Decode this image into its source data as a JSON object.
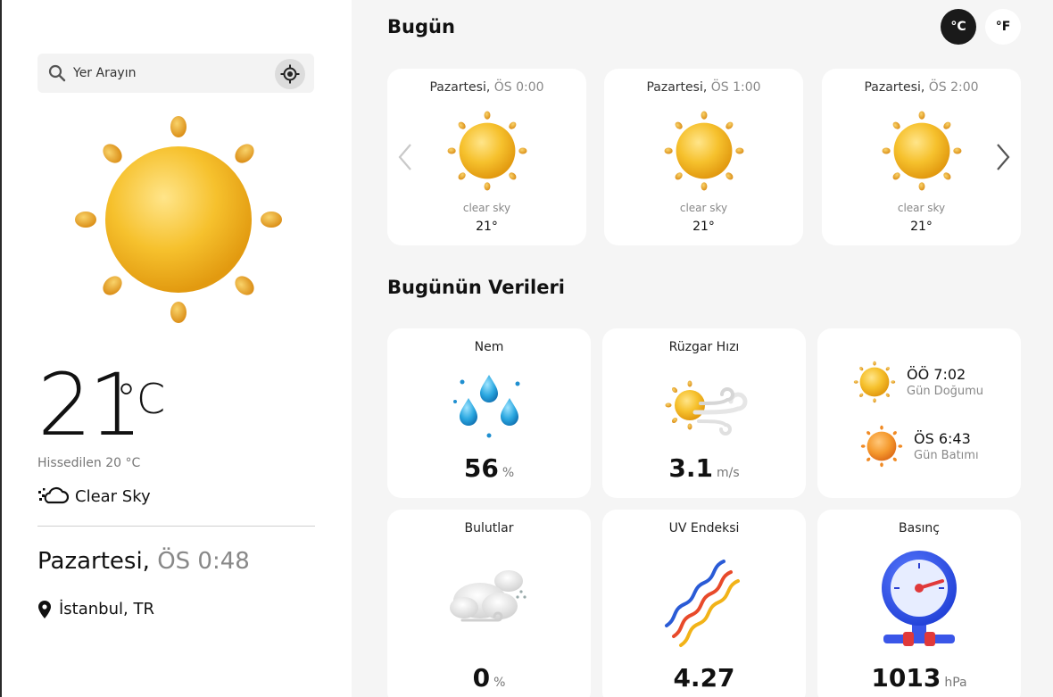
{
  "sidebar": {
    "search_placeholder": "Yer Arayın",
    "temperature": "21",
    "temperature_unit": "°C",
    "feels_like": "Hissedilen 20 °C",
    "condition": "Clear Sky",
    "day": "Pazartesi,",
    "time": "ÖS 0:48",
    "location": "İstanbul, TR"
  },
  "main": {
    "today_title": "Bugün",
    "unit_c": "°C",
    "unit_f": "°F",
    "hourly": [
      {
        "day": "Pazartesi,",
        "time": "ÖS 0:00",
        "desc": "clear sky",
        "temp": "21°"
      },
      {
        "day": "Pazartesi,",
        "time": "ÖS 1:00",
        "desc": "clear sky",
        "temp": "21°"
      },
      {
        "day": "Pazartesi,",
        "time": "ÖS 2:00",
        "desc": "clear sky",
        "temp": "21°"
      }
    ],
    "data_title": "Bugünün Verileri",
    "humidity": {
      "label": "Nem",
      "value": "56",
      "unit": "%"
    },
    "wind": {
      "label": "Rüzgar Hızı",
      "value": "3.1",
      "unit": "m/s"
    },
    "sunrise": {
      "time": "ÖÖ 7:02",
      "label": "Gün Doğumu"
    },
    "sunset": {
      "time": "ÖS 6:43",
      "label": "Gün Batımı"
    },
    "clouds": {
      "label": "Bulutlar",
      "value": "0",
      "unit": "%"
    },
    "uv": {
      "label": "UV Endeksi",
      "value": "4.27"
    },
    "pressure": {
      "label": "Basınç",
      "value": "1013",
      "unit": "hPa"
    }
  },
  "colors": {
    "sun": "#f5b921",
    "sunset_orange": "#f08a24",
    "accent_dark": "#1a1a1a"
  }
}
